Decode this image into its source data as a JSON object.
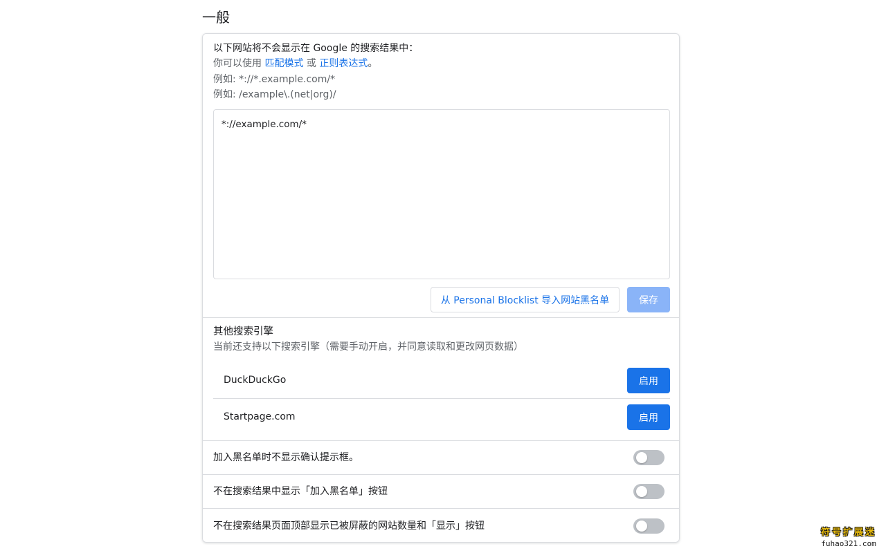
{
  "section": {
    "title": "一般"
  },
  "blocklist": {
    "desc_main": "以下网站将不会显示在 Google 的搜索结果中：",
    "desc_sub_prefix": "你可以使用 ",
    "link_match_pattern": "匹配模式",
    "desc_sub_or": " 或 ",
    "link_regex": "正则表达式",
    "desc_sub_suffix": "。",
    "example_1": "例如: *://*.example.com/*",
    "example_2": "例如: /example\\.(net|org)/",
    "textarea_value": "*://example.com/*",
    "import_label": "从 Personal Blocklist 导入网站黑名单",
    "save_label": "保存"
  },
  "engines": {
    "title": "其他搜索引擎",
    "subtitle": "当前还支持以下搜索引擎（需要手动开启，并同意读取和更改网页数据）",
    "items": [
      {
        "name": "DuckDuckGo",
        "button": "启用"
      },
      {
        "name": "Startpage.com",
        "button": "启用"
      }
    ]
  },
  "toggles": [
    {
      "label": "加入黑名单时不显示确认提示框。",
      "on": false
    },
    {
      "label": "不在搜索结果中显示「加入黑名单」按钮",
      "on": false
    },
    {
      "label": "不在搜索结果页面顶部显示已被屏蔽的网站数量和「显示」按钮",
      "on": false
    }
  ],
  "watermark": {
    "title": "符号扩展迷",
    "url": "fuhao321.com"
  },
  "colors": {
    "accent": "#1a73e8",
    "save_disabled": "#8ab4f8",
    "toggle_off": "#bdc1c6",
    "border": "#dadce0"
  }
}
